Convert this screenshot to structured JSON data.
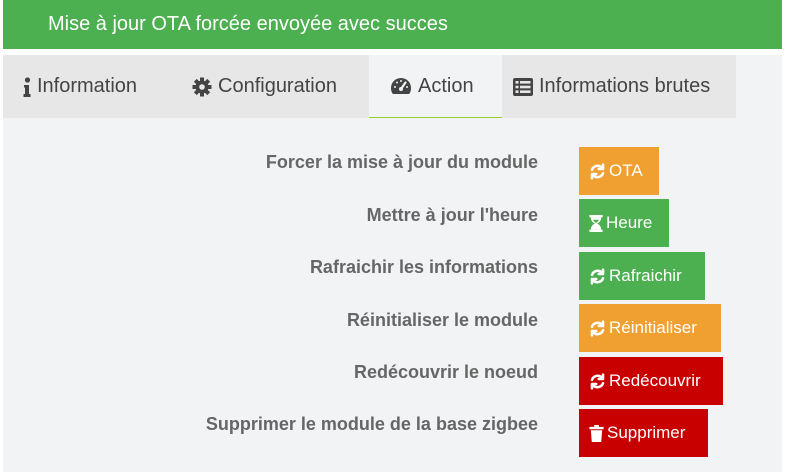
{
  "alert": {
    "message": "Mise à jour OTA forcée envoyée avec succes",
    "color": "#4caf50"
  },
  "tabs": [
    {
      "label": "Information",
      "icon": "info-icon",
      "active": false
    },
    {
      "label": "Configuration",
      "icon": "gear-icon",
      "active": false
    },
    {
      "label": "Action",
      "icon": "dashboard-icon",
      "active": true
    },
    {
      "label": "Informations brutes",
      "icon": "list-icon",
      "active": false
    }
  ],
  "actions": [
    {
      "label": "Forcer la mise à jour du module",
      "button": "OTA",
      "icon": "refresh-icon",
      "color": "#f0a030"
    },
    {
      "label": "Mettre à jour l'heure",
      "button": "Heure",
      "icon": "hourglass-icon",
      "color": "#4caf50"
    },
    {
      "label": "Rafraichir les informations",
      "button": "Rafraichir",
      "icon": "refresh-icon",
      "color": "#4caf50"
    },
    {
      "label": "Réinitialiser le module",
      "button": "Réinitialiser",
      "icon": "refresh-icon",
      "color": "#f0a030"
    },
    {
      "label": "Redécouvrir le noeud",
      "button": "Redécouvrir",
      "icon": "refresh-icon",
      "color": "#c80000"
    },
    {
      "label": "Supprimer le module de la base zigbee",
      "button": "Supprimer",
      "icon": "trash-icon",
      "color": "#c80000"
    }
  ]
}
